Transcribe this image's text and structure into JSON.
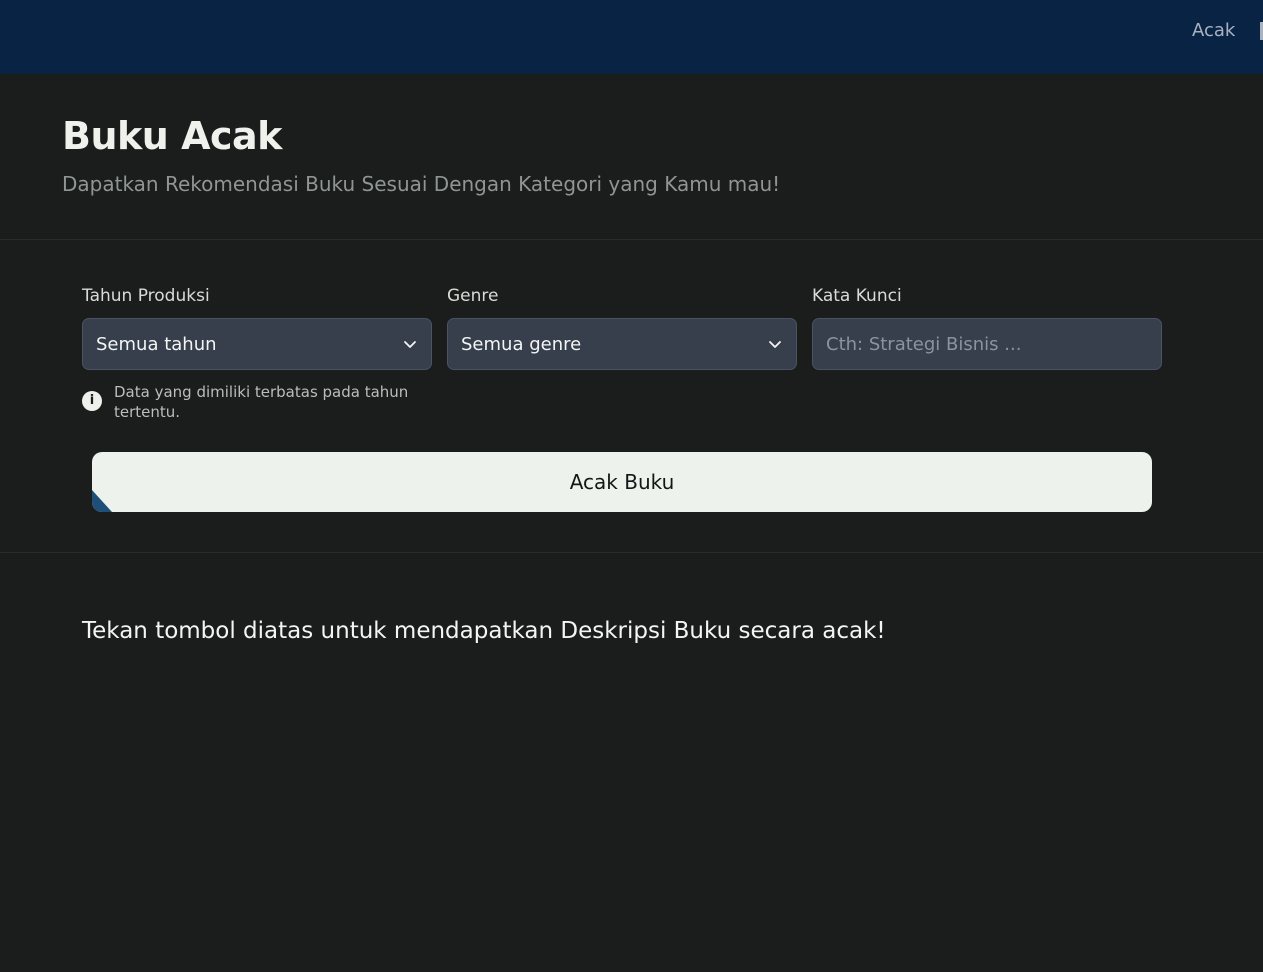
{
  "header": {
    "nav": [
      {
        "label": "Acak"
      }
    ]
  },
  "hero": {
    "title": "Buku Acak",
    "subtitle": "Dapatkan Rekomendasi Buku Sesuai Dengan Kategori yang Kamu mau!"
  },
  "form": {
    "year": {
      "label": "Tahun Produksi",
      "selected": "Semua tahun"
    },
    "genre": {
      "label": "Genre",
      "selected": "Semua genre"
    },
    "keyword": {
      "label": "Kata Kunci",
      "value": "",
      "placeholder": "Cth: Strategi Bisnis ..."
    },
    "note": {
      "text": "Data yang dimiliki terbatas pada tahun tertentu.",
      "icon": "info-icon"
    },
    "submit_label": "Acak Buku"
  },
  "result": {
    "message": "Tekan tombol diatas untuk mendapatkan Deskripsi Buku secara acak!"
  },
  "colors": {
    "header_bg": "#082343",
    "page_bg": "#1b1c1c",
    "input_bg": "#373f4d",
    "button_bg": "#eef2ec",
    "accent": "#1e4f79"
  }
}
